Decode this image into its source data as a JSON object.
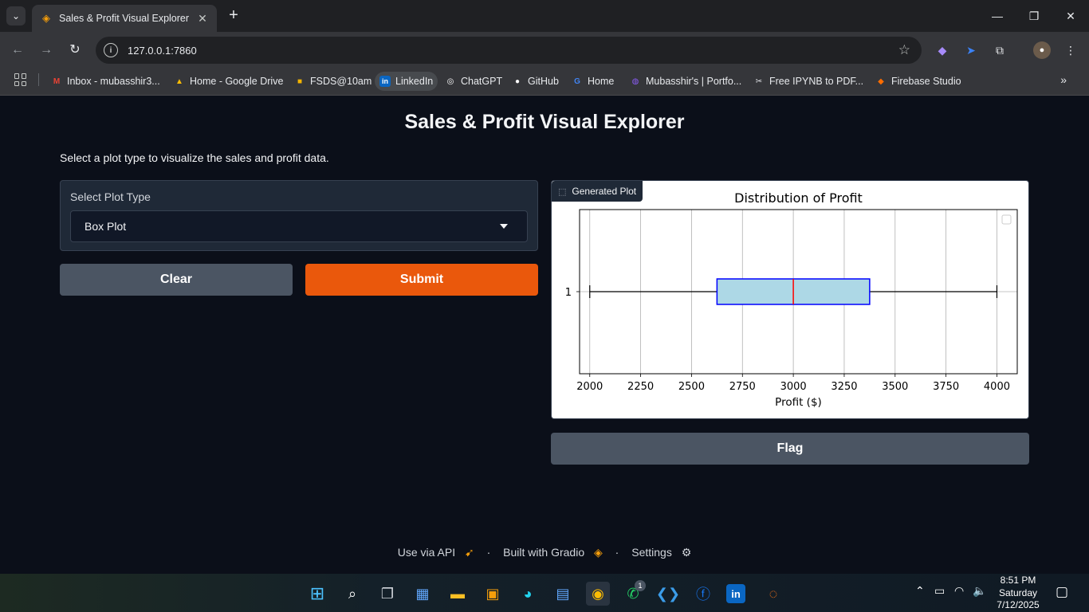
{
  "browser": {
    "tab_title": "Sales & Profit Visual Explorer",
    "url": "127.0.0.1:7860",
    "bookmarks": [
      {
        "label": "Inbox - mubasshir3...",
        "icon": "gmail-icon",
        "color": "#ea4335",
        "glyph": "M"
      },
      {
        "label": "Home - Google Drive",
        "icon": "google-drive-icon",
        "color": "#fbbc04",
        "glyph": "▲"
      },
      {
        "label": "FSDS@10am",
        "icon": "classroom-icon",
        "color": "#f4b400",
        "glyph": "■"
      },
      {
        "label": "LinkedIn",
        "icon": "linkedin-icon",
        "color": "#0a66c2",
        "glyph": "in"
      },
      {
        "label": "ChatGPT",
        "icon": "chatgpt-icon",
        "color": "#ffffff",
        "glyph": "◎"
      },
      {
        "label": "GitHub",
        "icon": "github-icon",
        "color": "#ffffff",
        "glyph": "●"
      },
      {
        "label": "Home",
        "icon": "google-icon",
        "color": "#4285f4",
        "glyph": "G"
      },
      {
        "label": "Mubasshir's | Portfo...",
        "icon": "portfolio-icon",
        "color": "#8b5cf6",
        "glyph": "◍"
      },
      {
        "label": "Free IPYNB to PDF...",
        "icon": "converter-icon",
        "color": "#e5e7eb",
        "glyph": "✂"
      },
      {
        "label": "Firebase Studio",
        "icon": "firebase-icon",
        "color": "#ff6d00",
        "glyph": "◆"
      }
    ]
  },
  "app": {
    "title": "Sales & Profit Visual Explorer",
    "description": "Select a plot type to visualize the sales and profit data.",
    "dropdown": {
      "label": "Select Plot Type",
      "value": "Box Plot"
    },
    "clear_label": "Clear",
    "submit_label": "Submit",
    "plot_label": "Generated Plot",
    "flag_label": "Flag",
    "accent_color": "#ea580c"
  },
  "footer": {
    "api": "Use via API",
    "built": "Built with Gradio",
    "settings": "Settings",
    "sep": "·"
  },
  "taskbar": {
    "time": "8:51 PM",
    "day": "Saturday",
    "date": "7/12/2025",
    "whatsapp_badge": "1"
  },
  "chart_data": {
    "type": "box",
    "title": "Distribution of Profit",
    "xlabel": "Profit ($)",
    "ylabel": "",
    "orientation": "horizontal",
    "categories": [
      "1"
    ],
    "box": {
      "whisker_low": 2000,
      "q1": 2625,
      "median": 3000,
      "q3": 3375,
      "whisker_high": 4000
    },
    "xlim": [
      1950,
      4100
    ],
    "xticks": [
      2000,
      2250,
      2500,
      2750,
      3000,
      3250,
      3500,
      3750,
      4000
    ],
    "grid": true,
    "legend": "top-right (empty)",
    "box_fill": "#add8e6",
    "box_edge": "#0000ff",
    "median_color": "#ff0000"
  }
}
